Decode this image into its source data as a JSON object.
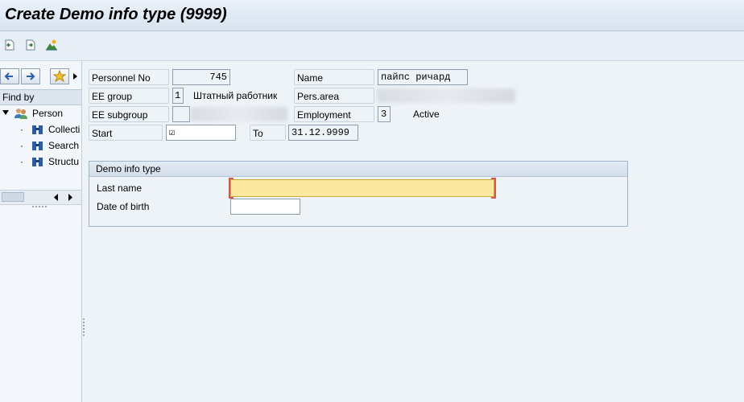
{
  "window": {
    "title": "Create Demo info type (9999)"
  },
  "toolbar": {
    "icons": [
      "back-icon",
      "forward-icon",
      "mountain-image-icon"
    ]
  },
  "left_panel": {
    "find_by": "Find by",
    "tree": [
      {
        "label": "Person",
        "icon": "people-icon"
      },
      {
        "label": "Collecti",
        "icon": "binoculars-icon"
      },
      {
        "label": "Search",
        "icon": "binoculars-icon"
      },
      {
        "label": "Structu",
        "icon": "binoculars-icon"
      }
    ]
  },
  "header": {
    "personnel_no_label": "Personnel No",
    "personnel_no": "745",
    "name_label": "Name",
    "name": "пайпс ричард",
    "ee_group_label": "EE group",
    "ee_group_code": "1",
    "ee_group_text": "Штатный работник",
    "pers_area_label": "Pers.area",
    "ee_subgroup_label": "EE subgroup",
    "employment_label": "Employment",
    "employment_code": "3",
    "employment_text": "Active",
    "start_label": "Start",
    "start_value": "☑",
    "to_label": "To",
    "to_value": "31.12.9999"
  },
  "demo_group": {
    "title": "Demo info type",
    "last_name_label": "Last name",
    "last_name_value": "",
    "dob_label": "Date of birth",
    "dob_value": ""
  },
  "colors": {
    "highlight_field": "#fbe9a0",
    "background": "#eef3f8"
  }
}
